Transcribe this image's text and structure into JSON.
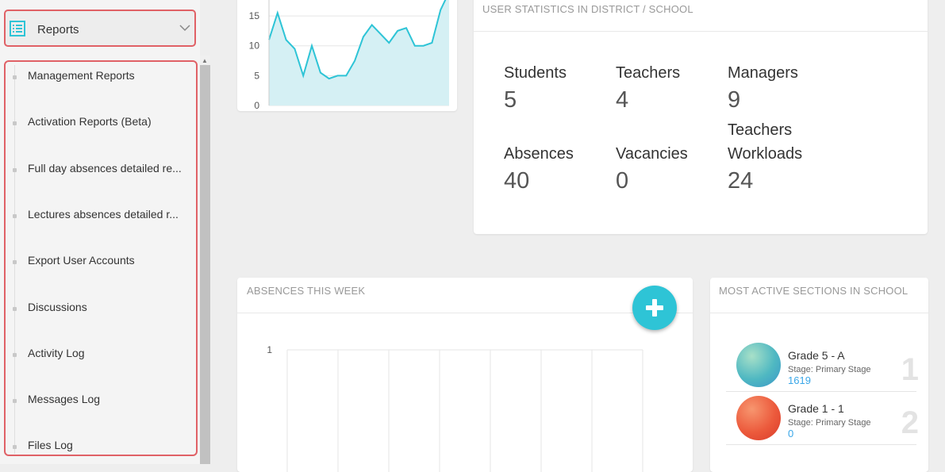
{
  "sidebar": {
    "header": {
      "label": "Reports"
    },
    "items": [
      {
        "label": "Management Reports"
      },
      {
        "label": "Activation Reports (Beta)"
      },
      {
        "label": "Full day absences detailed re..."
      },
      {
        "label": "Lectures absences detailed r..."
      },
      {
        "label": "Export User Accounts"
      },
      {
        "label": "Discussions"
      },
      {
        "label": "Activity Log"
      },
      {
        "label": "Messages Log"
      },
      {
        "label": "Files Log"
      }
    ]
  },
  "top_chart": {
    "chart_data": {
      "type": "area",
      "y_ticks": [
        "15",
        "10",
        "5",
        "0"
      ],
      "ylim": [
        0,
        19
      ],
      "values": [
        11,
        15.5,
        11,
        9.5,
        5,
        10,
        5.5,
        4.5,
        5,
        5,
        7.5,
        11.5,
        13.5,
        12,
        10.5,
        12.5,
        13,
        10,
        10,
        10.5,
        16,
        19
      ],
      "color": "#2ec4d6",
      "fill": "#d5f0f4"
    }
  },
  "user_stats": {
    "title": "USER STATISTICS IN DISTRICT / SCHOOL",
    "stats": [
      {
        "label": "Students",
        "value": "5"
      },
      {
        "label": "Teachers",
        "value": "4"
      },
      {
        "label": "Managers",
        "value": "9"
      },
      {
        "label": "Absences",
        "value": "40"
      },
      {
        "label": "Vacancies",
        "value": "0"
      },
      {
        "label": "Teachers",
        "label2": "Workloads",
        "value": "24"
      }
    ]
  },
  "absences": {
    "title": "ABSENCES THIS WEEK",
    "fab_icon": "plus-icon",
    "fab_color": "#2ec4d6",
    "chart_data": {
      "type": "bar",
      "y_ticks": [
        "1"
      ],
      "ylim": [
        0,
        1
      ],
      "categories_count": 7
    }
  },
  "active_sections": {
    "title": "MOST ACTIVE SECTIONS IN SCHOOL",
    "items": [
      {
        "name": "Grade 5 - A",
        "stage": "Stage: Primary Stage",
        "count": "1619",
        "rank": "1",
        "color": "#4fb8c2"
      },
      {
        "name": "Grade 1 - 1",
        "stage": "Stage: Primary Stage",
        "count": "0",
        "rank": "2",
        "color": "#ec5a3c"
      }
    ]
  }
}
